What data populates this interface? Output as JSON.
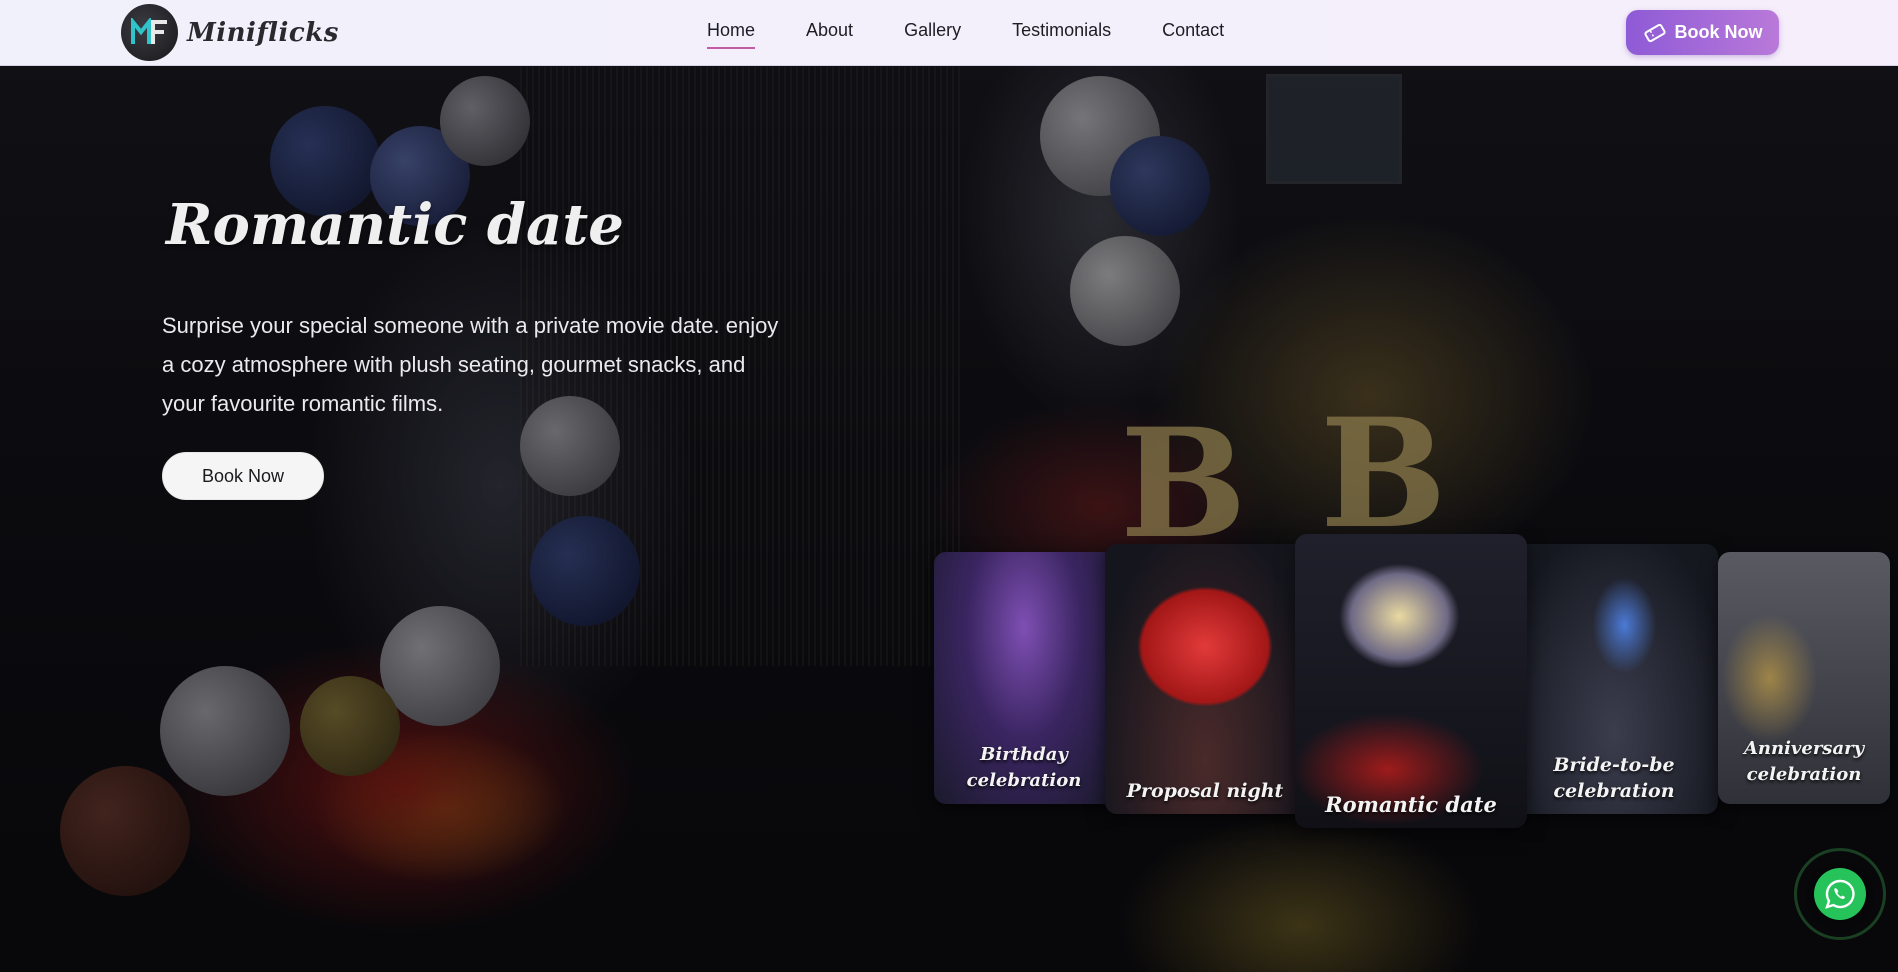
{
  "brand": {
    "name": "Miniflicks",
    "logo_icon": "mf-logo-icon"
  },
  "nav": {
    "items": [
      {
        "label": "Home",
        "active": true
      },
      {
        "label": "About"
      },
      {
        "label": "Gallery"
      },
      {
        "label": "Testimonials"
      },
      {
        "label": "Contact"
      }
    ],
    "book_label": "Book Now",
    "book_icon": "ticket-icon"
  },
  "hero": {
    "title": "Romantic date",
    "description": "Surprise your special someone with a private movie date. enjoy a cozy atmosphere with plush seating, gourmet snacks, and your favourite romantic films.",
    "cta_label": "Book Now"
  },
  "carousel": {
    "cards": [
      {
        "label": "Birthday celebration"
      },
      {
        "label": "Proposal night"
      },
      {
        "label": "Romantic date",
        "active": true
      },
      {
        "label": "Bride-to-be celebration"
      },
      {
        "label": "Anniversary celebration"
      }
    ]
  },
  "floating": {
    "whatsapp_icon": "whatsapp-icon"
  },
  "colors": {
    "accent_gradient_start": "#8e5ad6",
    "accent_gradient_end": "#b979d9",
    "active_underline": "#c25aa6",
    "whatsapp_green": "#25c35a"
  }
}
